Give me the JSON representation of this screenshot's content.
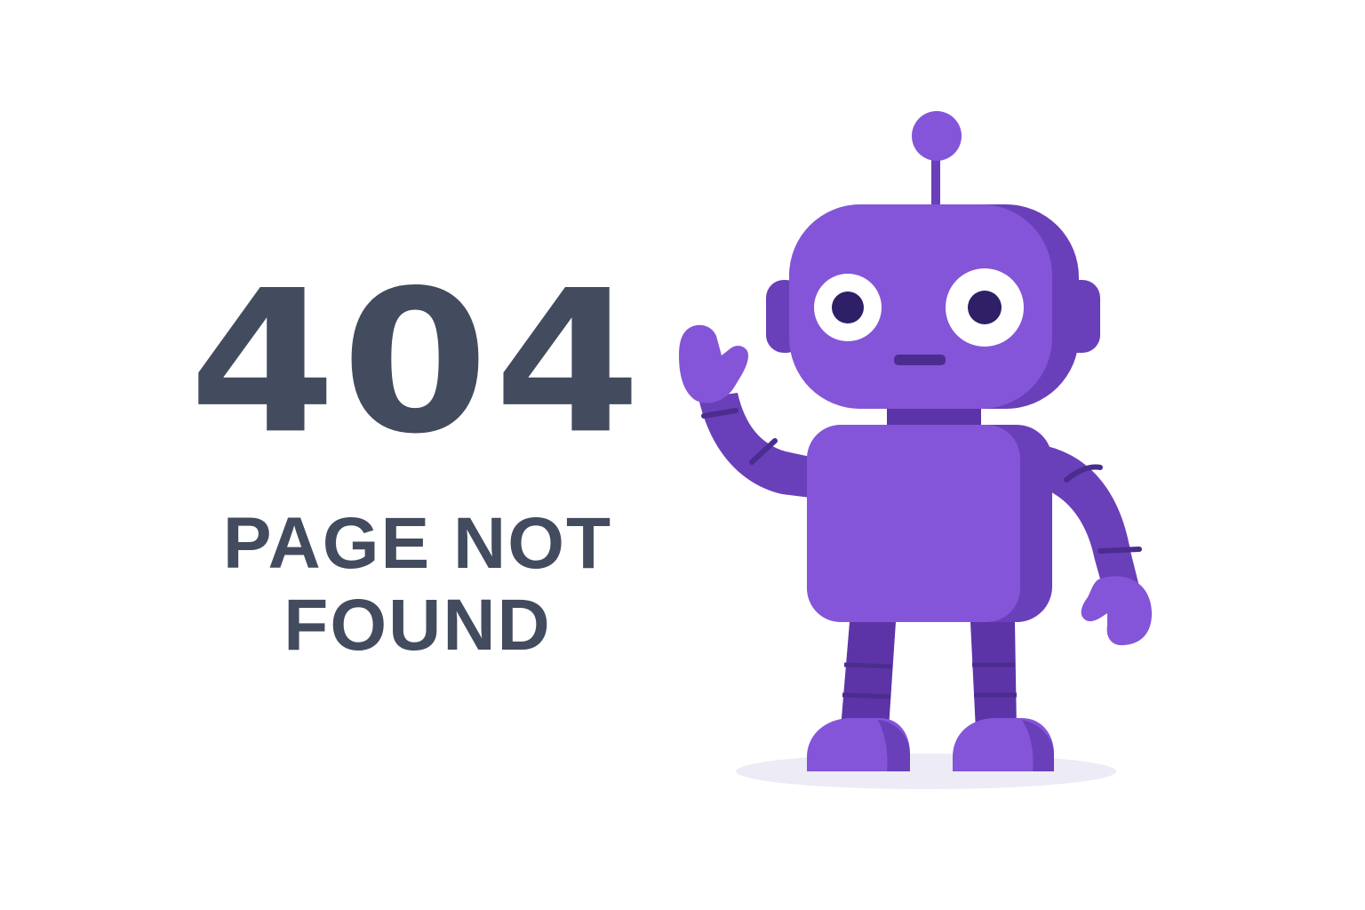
{
  "error": {
    "code": "404",
    "message_line1": "PAGE NOT",
    "message_line2": "FOUND"
  },
  "illustration": {
    "subject": "waving-robot",
    "colors": {
      "body": "#8455d8",
      "body_dark": "#6a3fba",
      "shade": "#5c34a7",
      "eye_white": "#ffffff",
      "pupil": "#2e1f66",
      "mouth": "#4a2d8e",
      "shadow": "#ecebf6"
    }
  },
  "theme": {
    "background": "#ffffff",
    "text": "#434b5e"
  }
}
